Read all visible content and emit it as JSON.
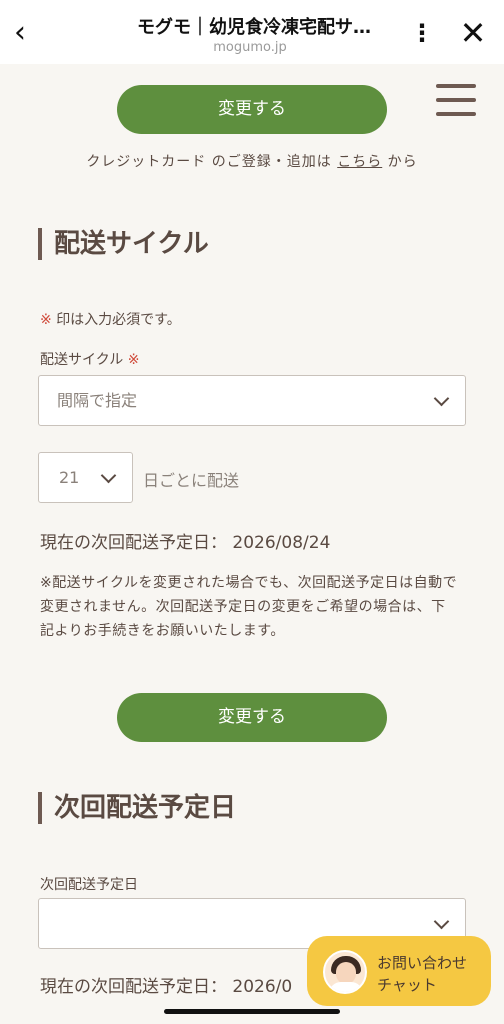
{
  "browser": {
    "title": "モグモ｜幼児食冷凍宅配サ…",
    "domain": "mogumo.jp",
    "back_glyph": "‹",
    "more_glyph": "⋮",
    "close_glyph": "✕"
  },
  "payment": {
    "change_button": "変更する",
    "note_prefix": "クレジットカード のご登録・追加は",
    "note_link": "こちら",
    "note_suffix": "から"
  },
  "cycle_section": {
    "title": "配送サイクル",
    "required_mark": "※",
    "required_note": "印は入力必須です。",
    "cycle_label": "配送サイクル",
    "cycle_select_value": "間隔で指定",
    "interval_value": "21",
    "interval_suffix": "日ごとに配送",
    "current_date_label": "現在の次回配送予定日：",
    "current_date_value": "2026/08/24",
    "notice": "※配送サイクルを変更された場合でも、次回配送予定日は自動で変更されません。次回配送予定日の変更をご希望の場合は、下記よりお手続きをお願いいたします。",
    "change_button": "変更する"
  },
  "next_date_section": {
    "title": "次回配送予定日",
    "field_label": "次回配送予定日",
    "select_value": "",
    "current_date_label": "現在の次回配送予定日：",
    "current_date_value": "2026/0"
  },
  "chat": {
    "line1": "お問い合わせ",
    "line2": "チャット"
  },
  "colors": {
    "accent_green": "#5e8f3e",
    "chat_yellow": "#f5c842",
    "required_red": "#d04a3a",
    "text_brown": "#5a4a42"
  }
}
